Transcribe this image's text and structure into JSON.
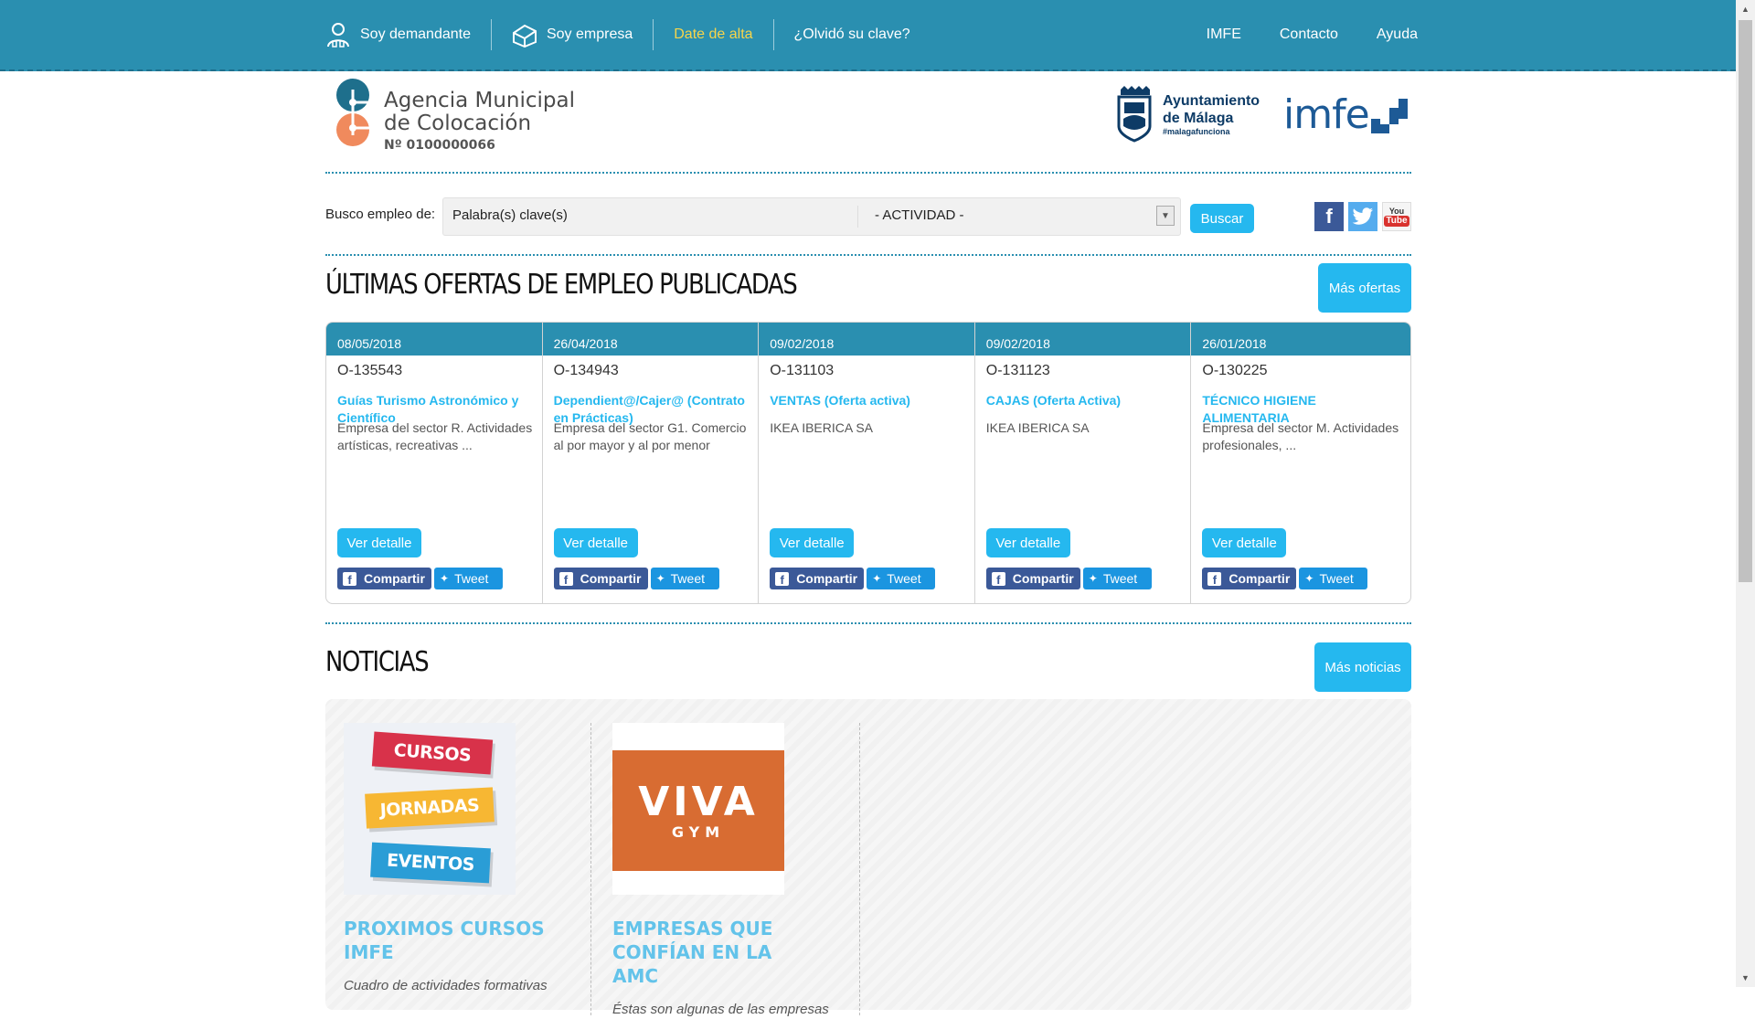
{
  "topnav": {
    "left": [
      {
        "label": "Soy demandante",
        "icon": "person-icon"
      },
      {
        "label": "Soy empresa",
        "icon": "company-icon"
      },
      {
        "label": "Date de alta"
      },
      {
        "label": "¿Olvidó su clave?"
      }
    ],
    "right": [
      {
        "label": "IMFE"
      },
      {
        "label": "Contacto"
      },
      {
        "label": "Ayuda"
      }
    ],
    "highlight_color": "#f7d54a"
  },
  "header": {
    "amc": {
      "line1": "Agencia Municipal",
      "line2": "de Colocación",
      "number": "Nº 0100000066"
    },
    "ayuntamiento": {
      "line1": "Ayuntamiento",
      "line2": "de Málaga",
      "tag": "#malagafunciona"
    },
    "imfe": "imfe"
  },
  "search": {
    "label": "Busco empleo de:",
    "keywords_placeholder": "Palabra(s) clave(s)",
    "activity_selected": "- ACTIVIDAD -",
    "button": "Buscar",
    "social": {
      "facebook": "f",
      "youtube_top": "You",
      "youtube_bottom": "Tube"
    }
  },
  "offers": {
    "title": "ÚLTIMAS OFERTAS DE EMPLEO PUBLICADAS",
    "more_button": "Más ofertas",
    "detail_button": "Ver detalle",
    "share_label": "Compartir",
    "tweet_label": "Tweet",
    "items": [
      {
        "date": "08/05/2018",
        "code": "O-135543",
        "title": "Guías Turismo Astronómico y Científico",
        "desc": "Empresa del sector R. Actividades artísticas, recreativas ..."
      },
      {
        "date": "26/04/2018",
        "code": "O-134943",
        "title": "Dependient@/Cajer@ (Contrato en Prácticas)",
        "desc": "Empresa del sector G1. Comercio al por mayor y al por menor"
      },
      {
        "date": "09/02/2018",
        "code": "O-131103",
        "title": "VENTAS (Oferta activa)",
        "desc": "IKEA IBERICA SA"
      },
      {
        "date": "09/02/2018",
        "code": "O-131123",
        "title": "CAJAS (Oferta Activa)",
        "desc": "IKEA IBERICA SA"
      },
      {
        "date": "26/01/2018",
        "code": "O-130225",
        "title": "TÉCNICO HIGIENE ALIMENTARIA",
        "desc": "Empresa del sector M. Actividades profesionales, ..."
      }
    ]
  },
  "news": {
    "title": "NOTICIAS",
    "more_button": "Más noticias",
    "items": [
      {
        "title": "PROXIMOS CURSOS IMFE",
        "desc": "Cuadro de actividades formativas",
        "ribbons": [
          "CURSOS",
          "JORNADAS",
          "EVENTOS"
        ]
      },
      {
        "title": "EMPRESAS QUE CONFÍAN EN LA AMC",
        "desc": "Éstas son algunas de las empresas",
        "logo_main": "VIVA",
        "logo_sub": "GYM"
      }
    ]
  },
  "colors": {
    "primary": "#2a8fb0",
    "accent": "#25b8ef",
    "link": "#25b8ef",
    "news_title": "#63c3ea"
  }
}
